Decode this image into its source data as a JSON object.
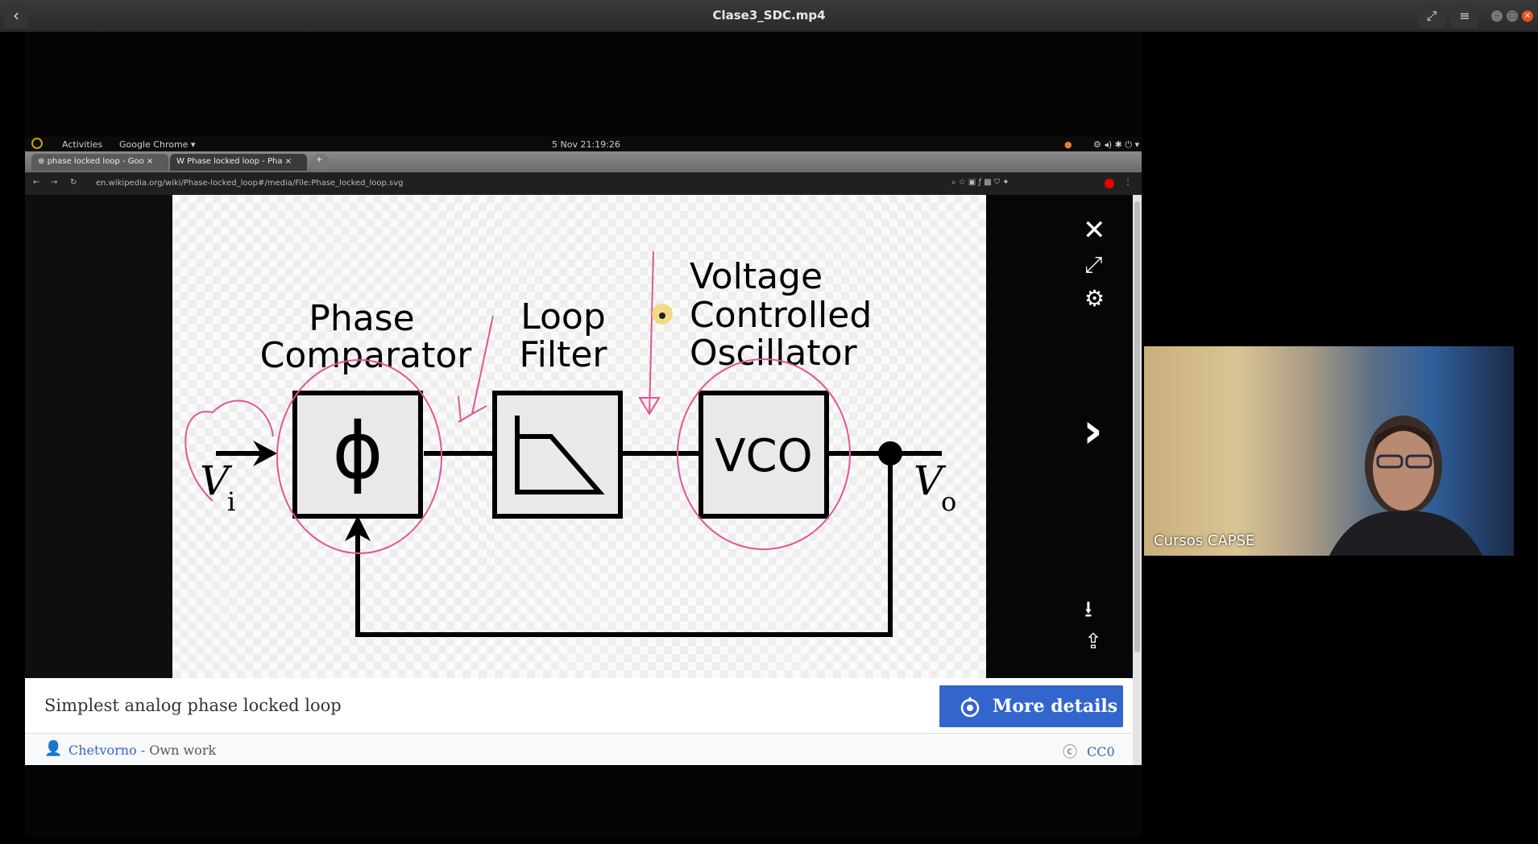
{
  "player": {
    "title": "Clase3_SDC.mp4",
    "back_icon": "chevron-left-icon",
    "fullscreen_icon": "expand-icon",
    "menu_icon": "hamburger-icon"
  },
  "desktop": {
    "activities": "Activities",
    "app_menu": "Google Chrome ▾",
    "clock": "5 Nov 21:19:26"
  },
  "browser": {
    "tabs": [
      {
        "label": "phase locked loop - Goo"
      },
      {
        "label": "Phase locked loop - Pha"
      }
    ],
    "url": "en.wikipedia.org/wiki/Phase-locked_loop#/media/File:Phase_locked_loop.svg"
  },
  "diagram": {
    "phase_comparator": [
      "Phase",
      "Comparator"
    ],
    "loop_filter": [
      "Loop",
      "Filter"
    ],
    "vco_label": [
      "Voltage",
      "Controlled",
      "Oscillator"
    ],
    "phi_symbol": "ϕ",
    "vco_text": "VCO",
    "input_label": "V",
    "input_sub": "i",
    "output_label": "V",
    "output_sub": "o"
  },
  "caption": {
    "text": "Simplest analog phase locked loop",
    "more_details": "More details"
  },
  "attribution": {
    "author": "Chetvorno",
    "suffix": " - Own work",
    "license": "CC0"
  },
  "webcam": {
    "name": "Cursos CAPSE"
  },
  "colors": {
    "accent": "#3366cc",
    "annotation": "#e0559a"
  }
}
